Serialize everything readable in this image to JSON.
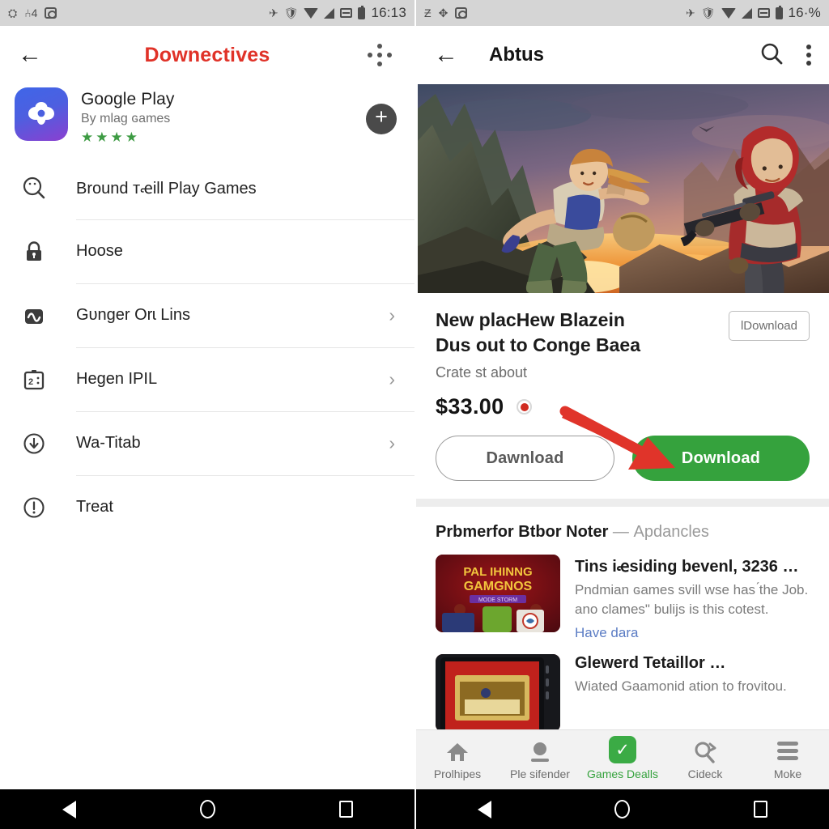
{
  "left": {
    "status_bar": {
      "icons": [
        "cast-icon",
        "sim-signal-icon",
        "screenshot-icon"
      ],
      "right_icons": [
        "airplane-icon",
        "shield-icon",
        "wifi-icon",
        "signal-icon",
        "sim-card-icon",
        "battery-icon"
      ],
      "time": "16:13"
    },
    "appbar": {
      "back_icon": "back-arrow-icon",
      "title": "Downectives",
      "overflow_icon": "apps-dots-icon"
    },
    "app_card": {
      "icon": "google-play-cloud-icon",
      "name": "Google Play",
      "developer": "By mlaɡ ɢames",
      "stars": "★★★★",
      "rating_count": 4,
      "add_button_icon": "plus-circle-icon",
      "add_button_label": "+"
    },
    "list": [
      {
        "icon": "search-face-icon",
        "label": "Bround ᴛꬴill Play Games",
        "chevron": false
      },
      {
        "icon": "lock-icon",
        "label": "Hoose",
        "chevron": false
      },
      {
        "icon": "wave-square-icon",
        "label": "Gᴜnger Orɩ Lins",
        "chevron": true
      },
      {
        "icon": "id-card-icon",
        "label": "Hegen IPIL",
        "chevron": true
      },
      {
        "icon": "download-circle-icon",
        "label": "Wa-Titab",
        "chevron": true
      },
      {
        "icon": "alert-circle-icon",
        "label": "Treat",
        "chevron": false
      }
    ],
    "chevron_glyph": "›",
    "nav": {
      "back": "nav-back-icon",
      "home": "nav-home-icon",
      "recents": "nav-recents-icon"
    }
  },
  "right": {
    "status_bar": {
      "icons": [
        "sleep-icon",
        "puzzle-icon",
        "screenshot-icon"
      ],
      "right_icons": [
        "airplane-icon",
        "shield-icon",
        "wifi-icon",
        "signal-icon",
        "sim-card-icon",
        "battery-icon"
      ],
      "battery_text": "16·%"
    },
    "appbar": {
      "back_icon": "back-arrow-icon",
      "title": "Abtus",
      "search_icon": "search-icon",
      "menu_icon": "kebab-menu-icon"
    },
    "hero": {
      "alt": "game-artwork-two-characters-lava-landscape"
    },
    "promo": {
      "title_line1": "New placHew Blazein",
      "title_line2": "Dus out to Congе Baеa",
      "subtitle": "Crate st about",
      "mini_button": "lDownload",
      "price": "$33.00",
      "price_dot_color": "#d02b20"
    },
    "actions": {
      "secondary_label": "Dawnload",
      "primary_label": "Download",
      "primary_color": "#35a23d",
      "arrow_color": "#e0342a"
    },
    "section": {
      "heading": "Prbmerfor Btbor Noter",
      "heading_dash": "—",
      "heading_muted": "Apdancles",
      "items": [
        {
          "thumb": "palihinng-gamgnos-thumbnail",
          "thumb_text_1": "PAL IHINNG",
          "thumb_text_2": "GAMGNOS",
          "thumb_text_3": "MODE STORM",
          "title": "Tins iꬴsiding bevenl, 3236 …",
          "desc_line1": "Pndmian ɢames sᴠill wse has ́the Job.",
          "desc_line2": "ano clames\" bulijs is this ᴄotest.",
          "link": "Have dara"
        },
        {
          "thumb": "tablet-red-screen-thumbnail",
          "title": "Glewerd Tetaillor …",
          "desc_line1": "Wiated Gaamᴏnid ation to frovitou."
        }
      ]
    },
    "bottom_nav": [
      {
        "icon": "home-icon",
        "label": "Prolhipes",
        "active": false
      },
      {
        "icon": "person-icon",
        "label": "Ple sifender",
        "active": false
      },
      {
        "icon": "check-badge-icon",
        "label": "Games Dealls",
        "active": true
      },
      {
        "icon": "search-cut-icon",
        "label": "Cideck",
        "active": false
      },
      {
        "icon": "menu-lines-icon",
        "label": "Moke",
        "active": false
      }
    ],
    "nav": {
      "back": "nav-back-icon",
      "home": "nav-home-icon",
      "recents": "nav-recents-icon"
    }
  }
}
